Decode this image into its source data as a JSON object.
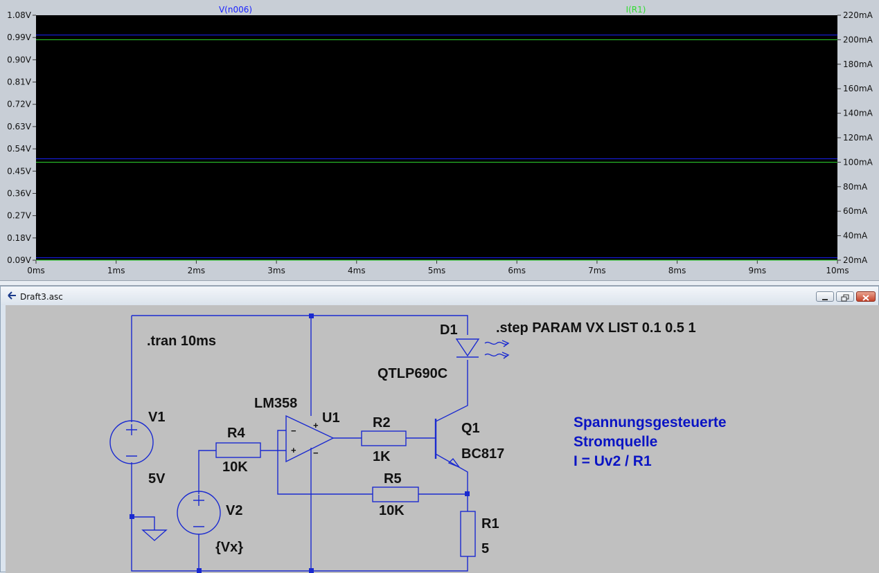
{
  "plot": {
    "traces": [
      {
        "name": "V(n006)",
        "color": "#1a22ff"
      },
      {
        "name": "I(R1)",
        "color": "#2fdc2f"
      }
    ],
    "left_axis_ticks": [
      "1.08V",
      "0.99V",
      "0.90V",
      "0.81V",
      "0.72V",
      "0.63V",
      "0.54V",
      "0.45V",
      "0.36V",
      "0.27V",
      "0.18V",
      "0.09V"
    ],
    "right_axis_ticks": [
      "220mA",
      "200mA",
      "180mA",
      "160mA",
      "140mA",
      "120mA",
      "100mA",
      "80mA",
      "60mA",
      "40mA",
      "20mA"
    ],
    "x_axis_ticks": [
      "0ms",
      "1ms",
      "2ms",
      "3ms",
      "4ms",
      "5ms",
      "6ms",
      "7ms",
      "8ms",
      "9ms",
      "10ms"
    ],
    "voltage_range": [
      0.09,
      1.08
    ],
    "current_range": [
      20,
      220
    ],
    "time_range": [
      0,
      10
    ],
    "voltage_levels": [
      1.0,
      0.5,
      0.1
    ],
    "current_levels": [
      200,
      100,
      20
    ],
    "background": "#000000"
  },
  "window": {
    "title": "Draft3.asc"
  },
  "schematic": {
    "directives": {
      "tran": ".tran 10ms",
      "step": ".step PARAM VX LIST 0.1 0.5 1"
    },
    "components": {
      "v1": {
        "ref": "V1",
        "value": "5V"
      },
      "v2": {
        "ref": "V2",
        "value": "{Vx}"
      },
      "r4": {
        "ref": "R4",
        "value": "10K"
      },
      "u1": {
        "ref": "U1",
        "value": "LM358"
      },
      "r2": {
        "ref": "R2",
        "value": "1K"
      },
      "q1": {
        "ref": "Q1",
        "value": "BC817"
      },
      "d1": {
        "ref": "D1",
        "value": "QTLP690C"
      },
      "r5": {
        "ref": "R5",
        "value": "10K"
      },
      "r1": {
        "ref": "R1",
        "value": "5"
      }
    },
    "opamp_pins": {
      "minus": "−",
      "plus": "+"
    },
    "comment_lines": [
      "Spannungsgesteuerte",
      "Stromquelle",
      "I = Uv2 / R1"
    ],
    "wire_color": "#1a2ad0",
    "note_color": "#0a14c4"
  }
}
